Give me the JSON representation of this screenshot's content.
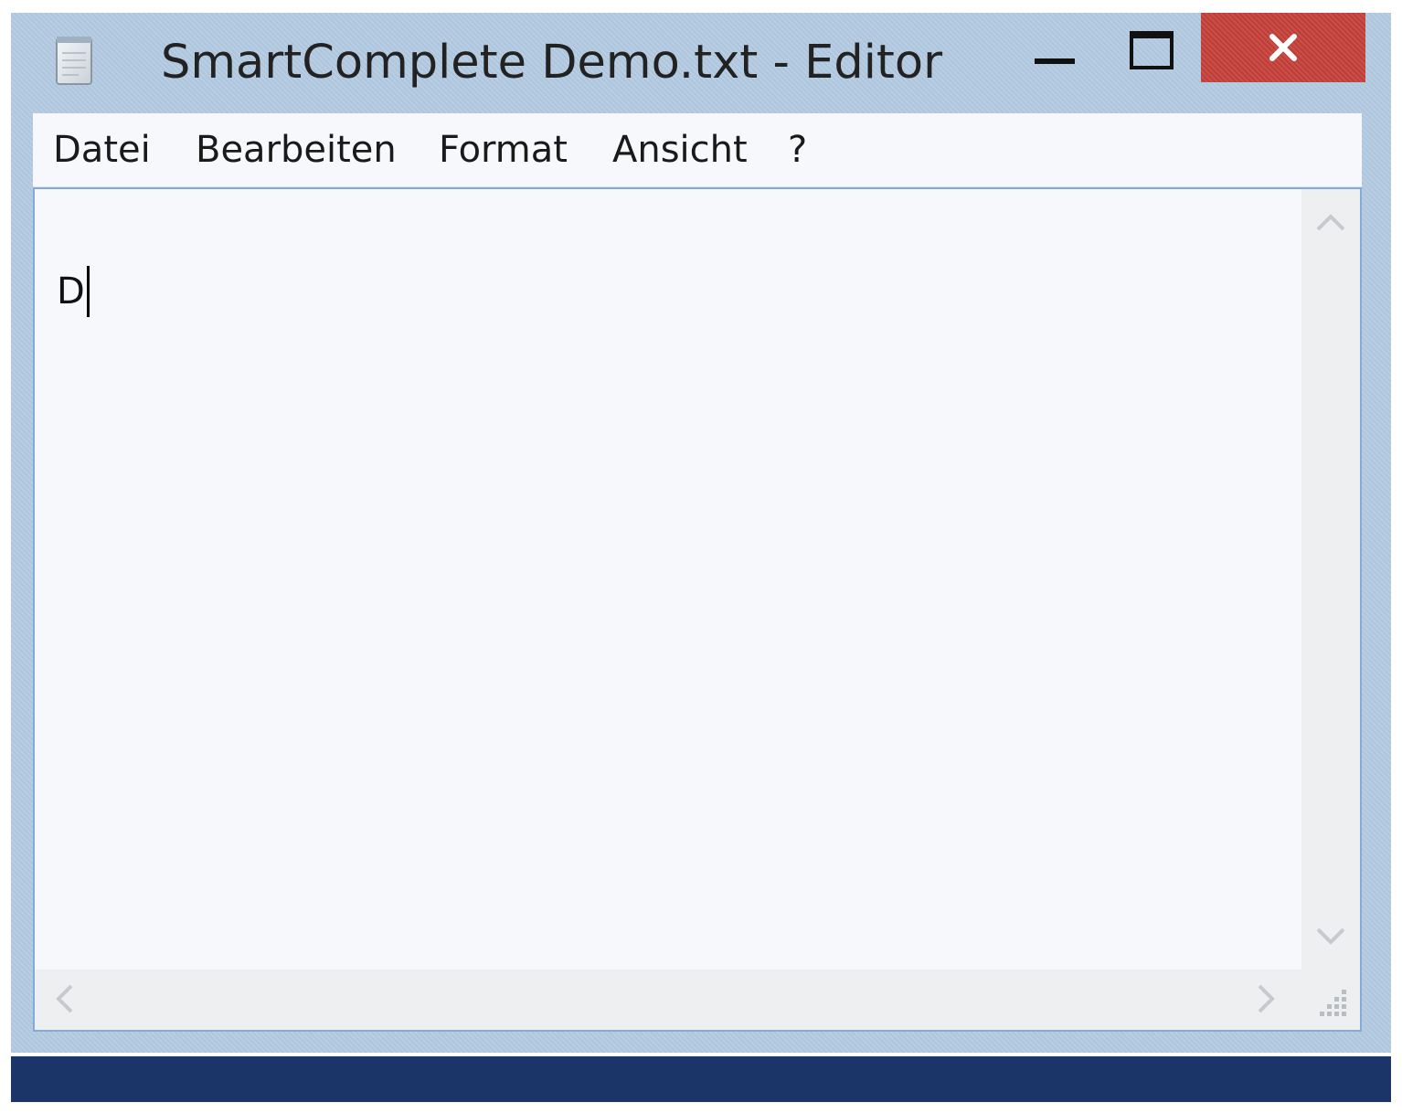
{
  "window": {
    "title": "SmartComplete Demo.txt - Editor",
    "icon": "notepad-icon"
  },
  "controls": {
    "minimize_icon": "minimize-icon",
    "maximize_icon": "maximize-icon",
    "close_icon": "close-icon",
    "close_color": "#c7403a"
  },
  "menu": {
    "items": [
      {
        "label": "Datei"
      },
      {
        "label": "Bearbeiten"
      },
      {
        "label": "Format"
      },
      {
        "label": "Ansicht"
      },
      {
        "label": "?"
      }
    ]
  },
  "editor": {
    "content": "D"
  },
  "scrollbars": {
    "up_icon": "chevron-up-icon",
    "down_icon": "chevron-down-icon",
    "left_icon": "chevron-left-icon",
    "right_icon": "chevron-right-icon",
    "grip_icon": "resize-grip-icon"
  },
  "colors": {
    "frame": "#b4cbe3",
    "taskbar": "#1b3568",
    "client_border": "#86aad8"
  }
}
